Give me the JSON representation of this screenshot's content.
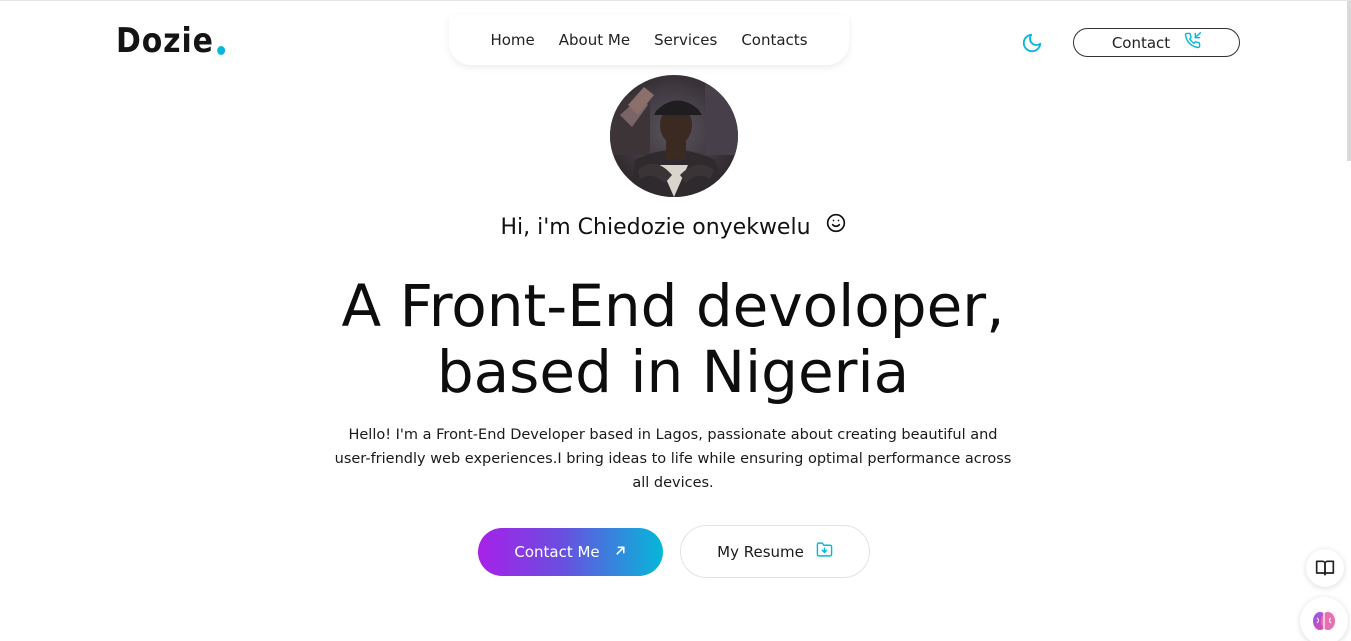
{
  "header": {
    "logo_text": "Dozie",
    "logo_dot_color": "#05b8d8",
    "nav": [
      {
        "label": "Home"
      },
      {
        "label": "About Me"
      },
      {
        "label": "Services"
      },
      {
        "label": "Contacts"
      }
    ],
    "theme_icon": "moon-icon",
    "contact_label": "Contact",
    "contact_icon": "phone-incoming-icon"
  },
  "hero": {
    "greeting": "Hi, i'm Chiedozie onyekwelu",
    "greeting_icon": "smile-icon",
    "headline_line1": "A Front-End devoloper,",
    "headline_line2": "based in Nigeria",
    "intro": "Hello! I'm a Front-End Developer based in Lagos, passionate about creating beautiful and user-friendly web experiences.I bring ideas to life while ensuring optimal performance across all devices.",
    "cta_label": "Contact Me",
    "cta_icon": "arrow-up-right-icon",
    "resume_label": "My Resume",
    "resume_icon": "folder-download-icon"
  },
  "colors": {
    "accent": "#05b8d8",
    "gradient_start": "#a721e8",
    "gradient_end": "#05b8d8"
  },
  "floating": {
    "reader_icon": "book-open-icon",
    "assistant_icon": "brain-icon"
  }
}
